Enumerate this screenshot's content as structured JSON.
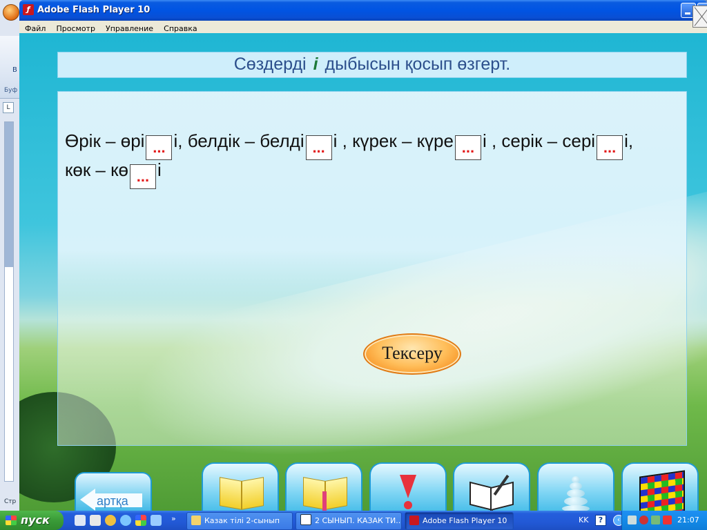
{
  "background_window": {
    "ribbon_letter": "В",
    "clipboard_label": "Буф",
    "status_label": "Стр"
  },
  "window": {
    "title": "Adobe Flash Player 10",
    "menu": [
      "Файл",
      "Просмотр",
      "Управление",
      "Справка"
    ]
  },
  "exercise": {
    "instruction_before": "Сөздерді",
    "instruction_letter": "і",
    "instruction_after": "дыбысын қосып өзгерт.",
    "blank_mark": "...",
    "line1": [
      {
        "pre": "Өрік – өрі",
        "post": "і, "
      },
      {
        "pre": "белдік – белді",
        "post": "і , "
      },
      {
        "pre": "күрек – күре",
        "post": "і , "
      },
      {
        "pre": "серік – сері",
        "post": "і,"
      }
    ],
    "line2": [
      {
        "pre": "көк – кө",
        "post": "і"
      }
    ],
    "check_button": "Тексеру"
  },
  "nav": {
    "back_label": "артқа",
    "buttons": [
      "book-icon",
      "book-bookmark-icon",
      "warning-icon",
      "open-book-pen-icon",
      "stones-pyramid-icon",
      "rubiks-cube-icon"
    ]
  },
  "taskbar": {
    "start_label": "пуск",
    "tasks": [
      {
        "label": "Казак тілі 2-сынып",
        "active": false
      },
      {
        "label": "2 СЫНЫП. КАЗАК ТИ...",
        "active": false
      },
      {
        "label": "Adobe Flash Player 10",
        "active": true
      }
    ],
    "language": "KK",
    "clock": "21:07"
  },
  "colors": {
    "title_blue": "#0054e3",
    "header_text": "#2c4f8c",
    "highlight_letter": "#1c7a3a",
    "blank_text": "#e31b1b",
    "check_orange": "#f58a1a",
    "taskbar_blue": "#245edc",
    "start_green": "#3a9b38"
  }
}
